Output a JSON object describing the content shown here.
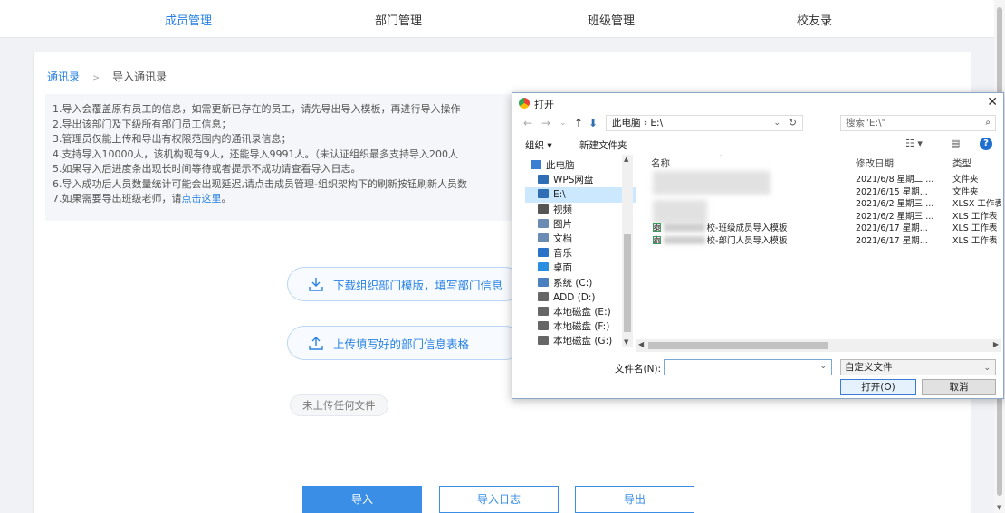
{
  "nav": {
    "items": [
      {
        "label": "成员管理",
        "active": true
      },
      {
        "label": "部门管理",
        "active": false
      },
      {
        "label": "班级管理",
        "active": false
      },
      {
        "label": "校友录",
        "active": false
      }
    ]
  },
  "breadcrumb": {
    "parent": "通讯录",
    "separator": ">",
    "current": "导入通讯录"
  },
  "notice": {
    "lines": [
      "1.导入会覆盖原有员工的信息，如需更新已存在的员工，请先导出导入模板，再进行导入操作",
      "2.导出该部门及下级所有部门员工信息；",
      "3.管理员仅能上传和导出有权限范围内的通讯录信息；",
      "4.支持导入10000人，该机构现有9人，还能导入9991人。（未认证组织最多支持导入200人",
      "5.如果导入后进度条出现长时间等待或者提示不成功请查看导入日志。",
      "6.导入成功后人员数量统计可能会出现延迟,请点击成员管理-组织架构下的刷新按钮刷新人员数",
      "7.如果需要导出班级老师，请"
    ],
    "link_text": "点击这里",
    "line7_end": "。"
  },
  "steps": {
    "download_label": "下载组织部门模版，填写部门信息",
    "upload_label": "上传填写好的部门信息表格",
    "no_file_label": "未上传任何文件"
  },
  "actions": {
    "import": "导入",
    "log": "导入日志",
    "export": "导出"
  },
  "dialog": {
    "title": "打开",
    "close": "✕",
    "address": "此电脑 › E:\\",
    "search_placeholder": "搜索\"E:\\\"",
    "organize": "组织 ▾",
    "new_folder": "新建文件夹",
    "nav_items": [
      {
        "label": "此电脑",
        "icon": "computer-icon",
        "color": "#3a7fd1"
      },
      {
        "label": "WPS网盘",
        "icon": "cloud-icon",
        "color": "#2f6db5"
      },
      {
        "label": "E:\\",
        "icon": "download-arrow-icon",
        "color": "#2f6db5",
        "selected": true
      },
      {
        "label": "视频",
        "icon": "video-icon",
        "color": "#555555"
      },
      {
        "label": "图片",
        "icon": "picture-icon",
        "color": "#6b8bb4"
      },
      {
        "label": "文档",
        "icon": "document-icon",
        "color": "#6b8bb4"
      },
      {
        "label": "音乐",
        "icon": "music-icon",
        "color": "#2a72c8"
      },
      {
        "label": "桌面",
        "icon": "desktop-icon",
        "color": "#2a8ee0"
      },
      {
        "label": "系统 (C:)",
        "icon": "drive-icon",
        "color": "#4a7fc0"
      },
      {
        "label": "ADD (D:)",
        "icon": "drive-icon",
        "color": "#666666"
      },
      {
        "label": "本地磁盘 (E:)",
        "icon": "drive-icon",
        "color": "#666666"
      },
      {
        "label": "本地磁盘 (F:)",
        "icon": "drive-icon",
        "color": "#666666"
      },
      {
        "label": "本地磁盘 (G:)",
        "icon": "drive-icon",
        "color": "#666666"
      }
    ],
    "columns": {
      "name": "名称",
      "date": "修改日期",
      "type": "类型"
    },
    "files": [
      {
        "name": "",
        "date": "2021/6/8 星期二 ...",
        "type": "文件夹"
      },
      {
        "name": "",
        "date": "2021/6/15 星期...",
        "type": "文件夹"
      },
      {
        "name": "",
        "date": "2021/6/2 星期三 ...",
        "type": "XLSX 工作表"
      },
      {
        "name": "",
        "date": "2021/6/2 星期三 ...",
        "type": "XLS 工作表"
      },
      {
        "name": "泰",
        "name_tail": "校-班级成员导入模板",
        "date": "2021/6/17 星期...",
        "type": "XLS 工作表"
      },
      {
        "name": "泰",
        "name_tail": "校-部门人员导入模板",
        "date": "2021/6/17 星期...",
        "type": "XLS 工作表"
      }
    ],
    "filename_label": "文件名(N):",
    "filename_value": "",
    "filetype_value": "自定义文件",
    "open_button": "打开(O)",
    "cancel_button": "取消"
  }
}
